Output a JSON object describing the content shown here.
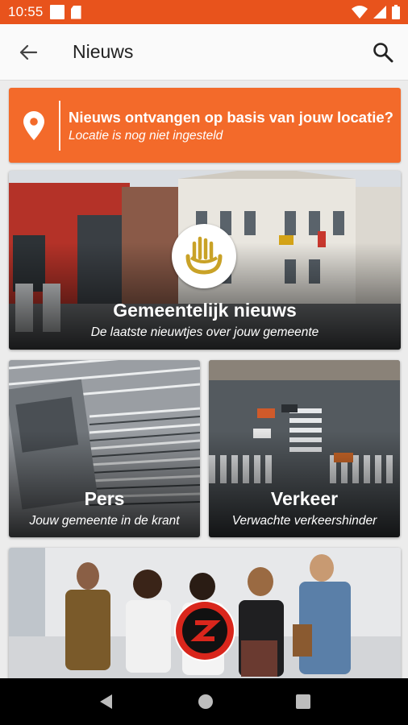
{
  "status_bar": {
    "time": "10:55"
  },
  "app_bar": {
    "title": "Nieuws"
  },
  "location_banner": {
    "title": "Nieuws ontvangen op basis van jouw locatie?",
    "subtitle": "Locatie is nog niet ingesteld"
  },
  "cards": [
    {
      "title": "Gemeentelijk nieuws",
      "subtitle": "De laatste nieuwtjes over jouw gemeente"
    },
    {
      "title": "Pers",
      "subtitle": "Jouw gemeente in de krant"
    },
    {
      "title": "Verkeer",
      "subtitle": "Verwachte verkeershinder"
    }
  ],
  "colors": {
    "accent": "#e8531c",
    "banner": "#f36a2a",
    "logo_gold": "#c9a227",
    "logo_red": "#d9261c"
  },
  "icons": [
    "back-arrow-icon",
    "search-icon",
    "location-pin-icon",
    "nav-back-icon",
    "nav-home-icon",
    "nav-recents-icon"
  ]
}
